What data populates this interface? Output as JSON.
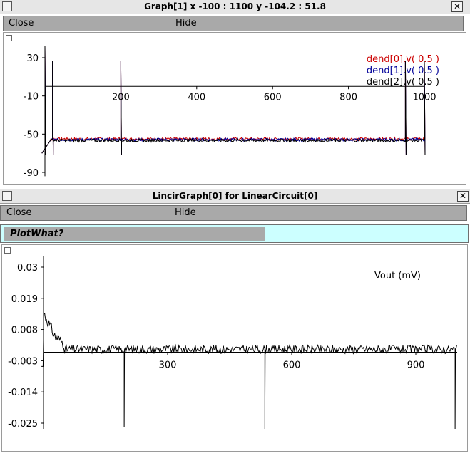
{
  "graph1": {
    "title": "Graph[1]  x -100 : 1100  y -104.2 : 51.8",
    "close_glyph": "✕",
    "menu": {
      "close": "Close",
      "hide": "Hide"
    },
    "y_ticks": [
      "30",
      "-10",
      "-50",
      "-90"
    ],
    "x_ticks": [
      "200",
      "400",
      "600",
      "800",
      "1000"
    ],
    "x_zero_label": "-10",
    "legend": [
      {
        "label": "dend[0].v( 0.5 )",
        "color": "#cc0000"
      },
      {
        "label": "dend[1].v( 0.5 )",
        "color": "#000099"
      },
      {
        "label": "dend[2].v( 0.5 )",
        "color": "#000000"
      }
    ]
  },
  "graph2": {
    "title": "LincirGraph[0] for LinearCircuit[0]",
    "close_glyph": "✕",
    "menu": {
      "close": "Close",
      "hide": "Hide"
    },
    "plotwhat_label": "PlotWhat?",
    "y_ticks": [
      "0.03",
      "0.019",
      "0.008",
      "-0.003",
      "-0.014",
      "-0.025"
    ],
    "x_ticks": [
      "300",
      "600",
      "900"
    ],
    "trace_label": "Vout (mV)"
  },
  "colors": {
    "titlebar": "#e6e6e6",
    "menubar": "#a9a9a9",
    "plotwhat_bg": "#ccffff"
  }
}
